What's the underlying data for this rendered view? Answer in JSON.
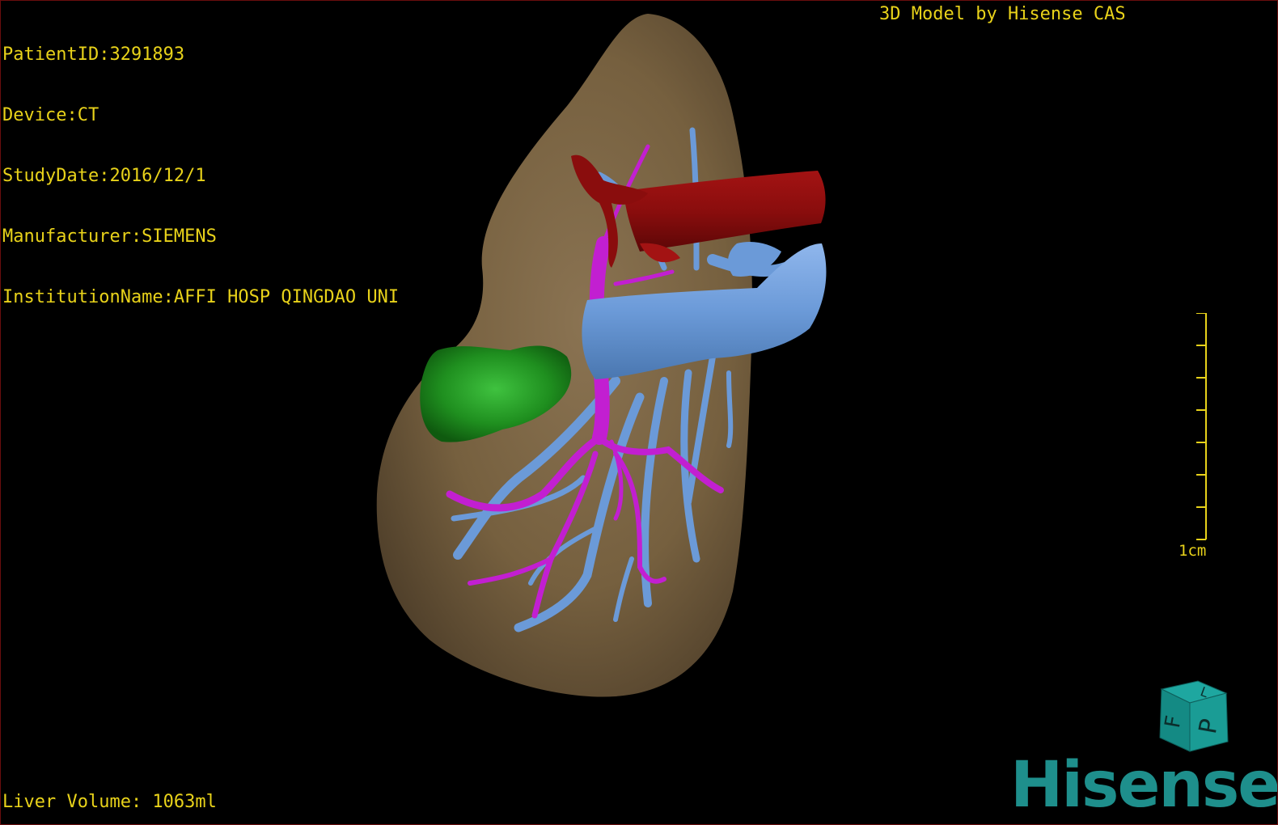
{
  "overlay": {
    "patient_id": "PatientID:3291893",
    "device": "Device:CT",
    "study_date": "StudyDate:2016/12/1",
    "manufacturer": "Manufacturer:SIEMENS",
    "institution": "InstitutionName:AFFI HOSP QINGDAO UNI",
    "model_credit": "3D Model by Hisense CAS",
    "liver_volume": "Liver Volume: 1063ml"
  },
  "scale_bar": {
    "label": "1cm",
    "ticks": 8
  },
  "orientation_cube": {
    "face_left": "F",
    "face_front": "P",
    "face_top": "L"
  },
  "brand": {
    "logo_text": "Hisense",
    "color": "#1e8f8c"
  },
  "colors": {
    "text": "#e8d21a",
    "liver": "#7b6448",
    "hepatic_vein": "#6b9ad8",
    "portal_vein": "#c21fd1",
    "inferior_vena_cava": "#8a0d0d",
    "gallbladder": "#1f8f1f",
    "border": "#6a0e0e"
  },
  "structures": [
    {
      "name": "liver",
      "color": "#7b6448"
    },
    {
      "name": "inferior_vena_cava",
      "color": "#8a0d0d"
    },
    {
      "name": "hepatic_vein",
      "color": "#6b9ad8"
    },
    {
      "name": "portal_vein",
      "color": "#c21fd1"
    },
    {
      "name": "gallbladder",
      "color": "#1f8f1f"
    }
  ]
}
